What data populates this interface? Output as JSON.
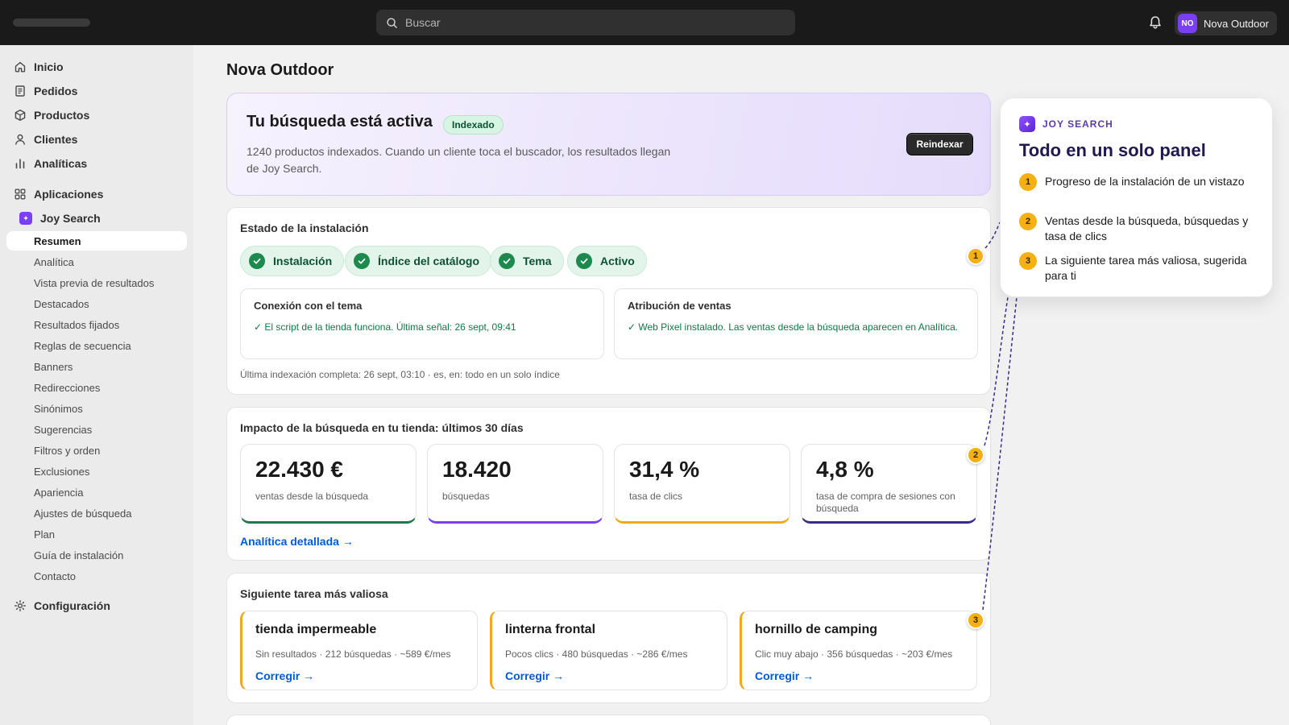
{
  "topbar": {
    "search_placeholder": "Buscar",
    "account_initials": "NO",
    "account_name": "Nova Outdoor"
  },
  "sidebar": {
    "main": [
      {
        "label": "Inicio",
        "icon": "home-icon"
      },
      {
        "label": "Pedidos",
        "icon": "orders-icon"
      },
      {
        "label": "Productos",
        "icon": "product-icon"
      },
      {
        "label": "Clientes",
        "icon": "person-icon"
      },
      {
        "label": "Analíticas",
        "icon": "chart-icon"
      }
    ],
    "apps_label": "Aplicaciones",
    "app_name": "Joy Search",
    "app_items": [
      "Resumen",
      "Analítica",
      "Vista previa de resultados",
      "Destacados",
      "Resultados fijados",
      "Reglas de secuencia",
      "Banners",
      "Redirecciones",
      "Sinónimos",
      "Sugerencias",
      "Filtros y orden",
      "Exclusiones",
      "Apariencia",
      "Ajustes de búsqueda",
      "Plan",
      "Guía de instalación",
      "Contacto"
    ],
    "active_item": "Resumen",
    "settings_label": "Configuración"
  },
  "page": {
    "title": "Nova Outdoor"
  },
  "hero": {
    "title": "Tu búsqueda está activa",
    "badge": "Indexado",
    "description": "1240 productos indexados. Cuando un cliente toca el buscador, los resultados llegan de Joy Search.",
    "button": "Reindexar"
  },
  "install": {
    "title": "Estado de la instalación",
    "steps": [
      "Instalación",
      "Índice del catálogo",
      "Tema",
      "Activo"
    ],
    "theme_box": {
      "title": "Conexión con el tema",
      "text": "✓ El script de la tienda funciona. Última señal: 26 sept, 09:41"
    },
    "sales_box": {
      "title": "Atribución de ventas",
      "text": "✓ Web Pixel instalado. Las ventas desde la búsqueda aparecen en Analítica."
    },
    "footnote": "Última indexación completa: 26 sept, 03:10 · es, en: todo en un solo índice"
  },
  "impact": {
    "title": "Impacto de la búsqueda en tu tienda: últimos 30 días",
    "metrics": [
      {
        "value": "22.430 €",
        "label": "ventas desde la búsqueda",
        "color": "#1c7a4c"
      },
      {
        "value": "18.420",
        "label": "búsquedas",
        "color": "#7a3ff0"
      },
      {
        "value": "31,4 %",
        "label": "tasa de clics",
        "color": "#f0a81c"
      },
      {
        "value": "4,8 %",
        "label": "tasa de compra de sesiones con búsqueda",
        "color": "#3b2a8a"
      }
    ],
    "link": "Analítica detallada →"
  },
  "tasks": {
    "title": "Siguiente tarea más valiosa",
    "items": [
      {
        "title": "tienda impermeable",
        "meta": "Sin resultados · 212 búsquedas · ~589 €/mes",
        "link": "Corregir →"
      },
      {
        "title": "linterna frontal",
        "meta": "Pocos clics · 480 búsquedas · ~286 €/mes",
        "link": "Corregir →"
      },
      {
        "title": "hornillo de camping",
        "meta": "Clic muy abajo · 356 búsquedas · ~203 €/mes",
        "link": "Corregir →"
      }
    ]
  },
  "markers": [
    "1",
    "2",
    "3"
  ],
  "callout": {
    "brand": "JOY SEARCH",
    "title": "Todo en un solo panel",
    "items": [
      {
        "num": "1",
        "text": "Progreso de la instalación de un vistazo"
      },
      {
        "num": "2",
        "text": "Ventas desde la búsqueda, búsquedas y tasa de clics"
      },
      {
        "num": "3",
        "text": "La siguiente tarea más valiosa, sugerida para ti"
      }
    ]
  },
  "colors": {
    "accent_purple": "#7a3ff0",
    "success_green": "#1c8a4c",
    "marker_amber": "#f5b013",
    "link_blue": "#005bd3"
  }
}
